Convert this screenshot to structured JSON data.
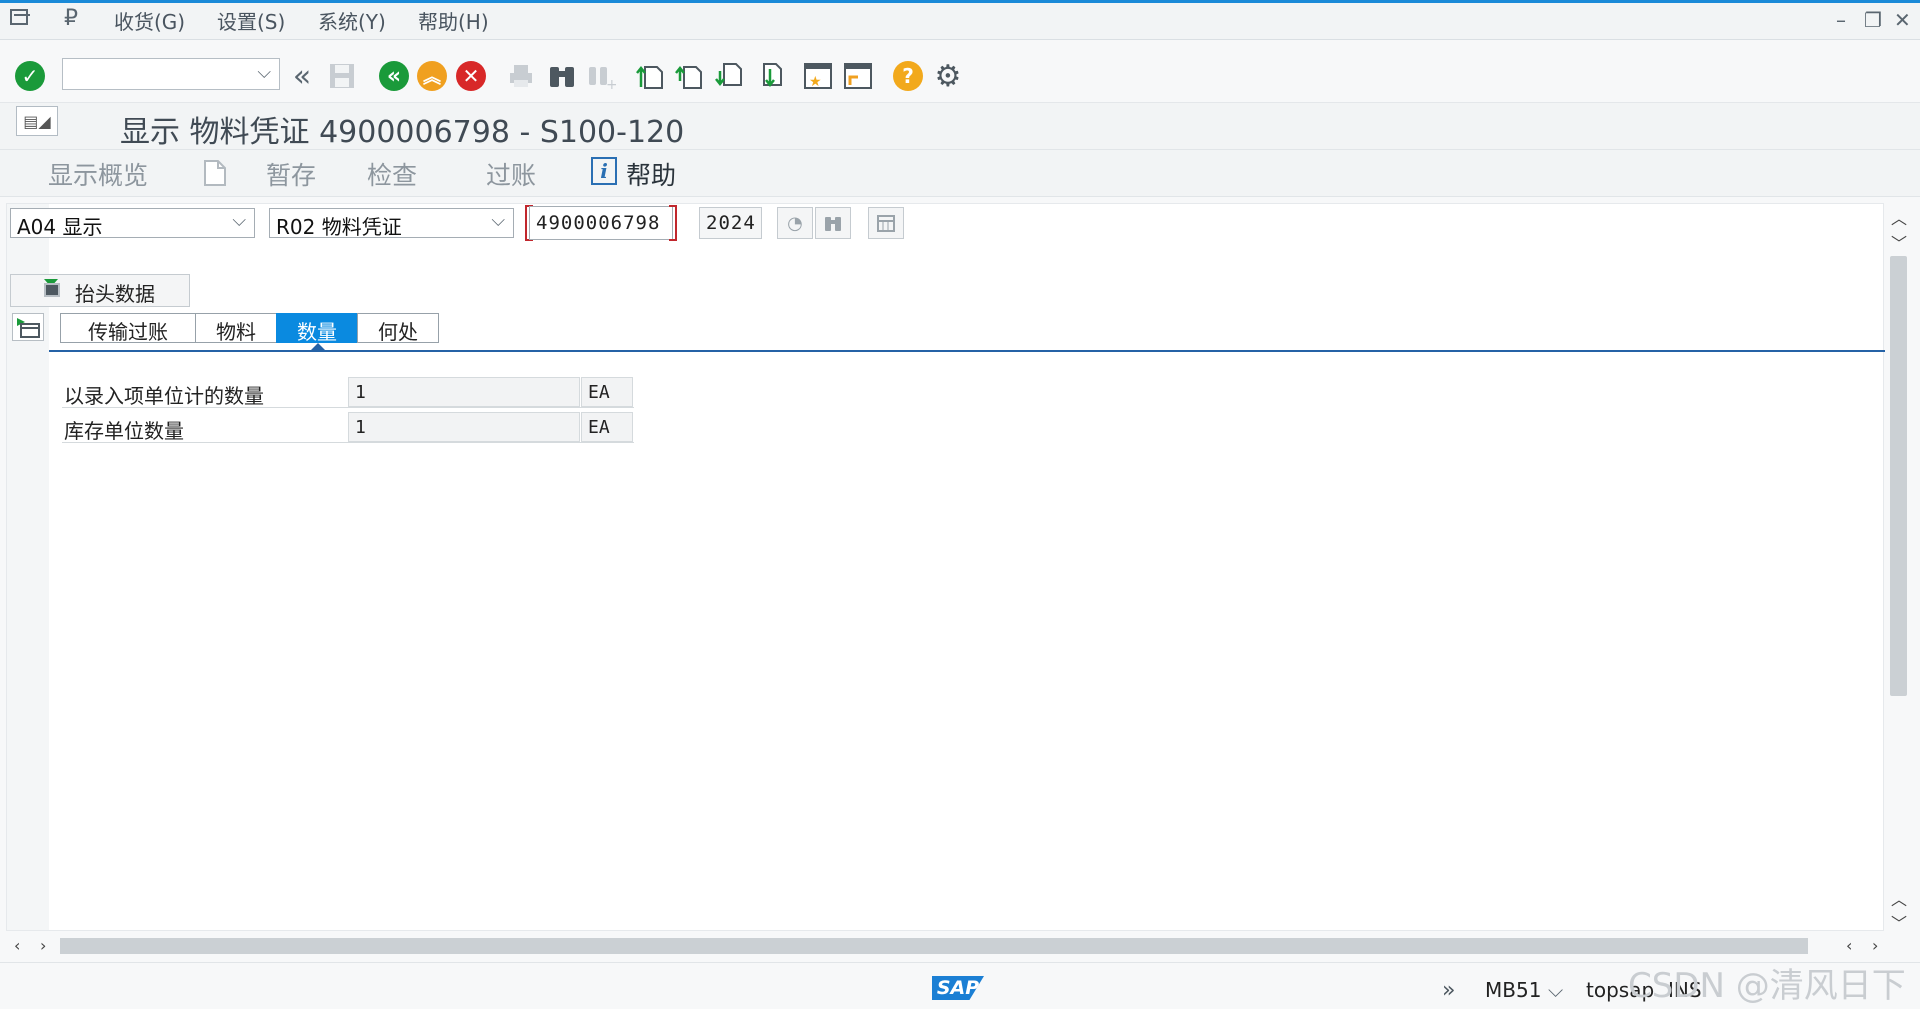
{
  "menu": {
    "items": [
      "收货(G)",
      "设置(S)",
      "系统(Y)",
      "帮助(H)"
    ]
  },
  "toolbar": {
    "command_value": "",
    "icons": [
      "enter-icon",
      "back-double-icon",
      "save-icon",
      "back-icon",
      "exit-icon",
      "cancel-icon",
      "print-icon",
      "find-icon",
      "find-next-icon",
      "first-page-icon",
      "prev-page-icon",
      "next-page-icon",
      "last-page-icon",
      "create-session-icon",
      "shortcut-icon",
      "help-icon",
      "settings-icon"
    ]
  },
  "title": "显示 物料凭证 4900006798 - S100-120",
  "app_toolbar": {
    "overview": "显示概览",
    "hold": "暂存",
    "check": "检查",
    "post": "过账",
    "help": "帮助"
  },
  "selection": {
    "action": "A04 显示",
    "reference": "R02 物料凭证",
    "doc_number": "4900006798",
    "year": "2024"
  },
  "header_toggle": "抬头数据",
  "tabs": [
    {
      "label": "传输过账",
      "active": false
    },
    {
      "label": "物料",
      "active": false
    },
    {
      "label": "数量",
      "active": true
    },
    {
      "label": "何处",
      "active": false
    }
  ],
  "quantity": {
    "rows": [
      {
        "label": "以录入项单位计的数量",
        "value": "1",
        "unit": "EA"
      },
      {
        "label": "库存单位数量",
        "value": "1",
        "unit": "EA"
      }
    ]
  },
  "status": {
    "logo": "SAP",
    "transaction": "MB51",
    "server": "topsap",
    "mode": "INS"
  },
  "watermark": "CSDN @清风日下",
  "colors": {
    "accent": "#0a8ae0",
    "ok_green": "#1a9a3a",
    "exit_orange": "#f0a020",
    "cancel_red": "#d82828",
    "help_yellow": "#f2a91c"
  }
}
